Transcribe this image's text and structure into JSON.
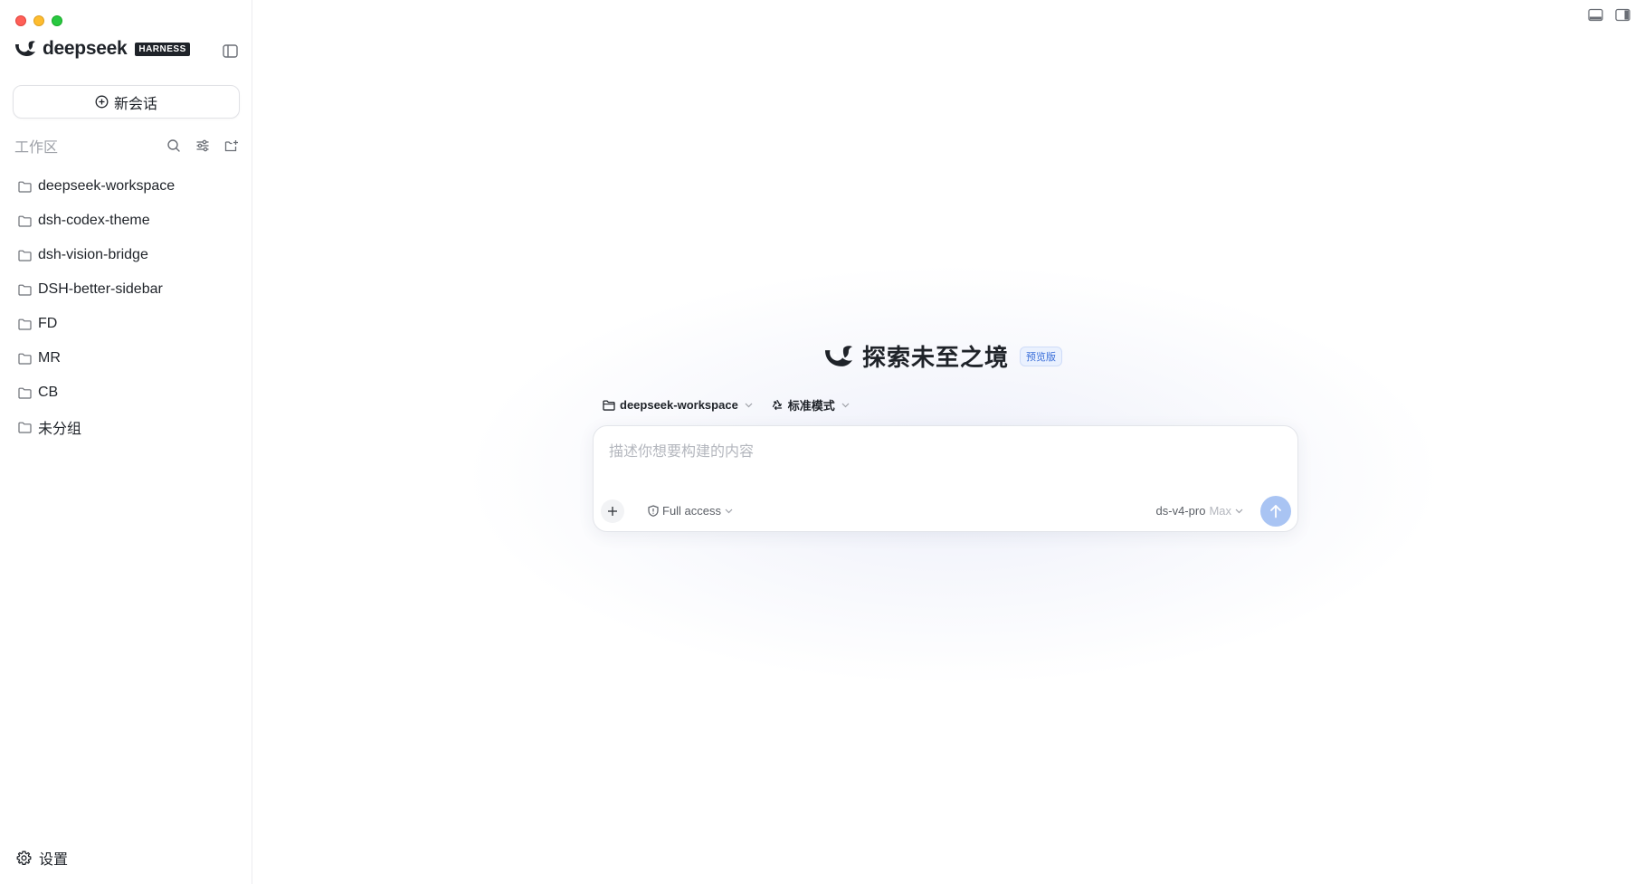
{
  "brand": {
    "name": "deepseek",
    "badge": "HARNESS"
  },
  "sidebar": {
    "new_chat_label": "新会话",
    "workspace_title": "工作区",
    "folders": [
      {
        "label": "deepseek-workspace"
      },
      {
        "label": "dsh-codex-theme"
      },
      {
        "label": "dsh-vision-bridge"
      },
      {
        "label": "DSH-better-sidebar"
      },
      {
        "label": "FD"
      },
      {
        "label": "MR"
      },
      {
        "label": "CB"
      },
      {
        "label": "未分组"
      }
    ],
    "settings_label": "设置"
  },
  "main": {
    "hero_title": "探索未至之境",
    "hero_badge": "预览版",
    "workspace_selector": "deepseek-workspace",
    "mode_selector": "标准模式",
    "composer": {
      "placeholder": "描述你想要构建的内容",
      "value": "",
      "access_label": "Full access",
      "model_name": "ds-v4-pro",
      "model_effort": "Max"
    }
  },
  "colors": {
    "accent": "#3b6fd9",
    "send_button": "#a9c4f3",
    "badge_bg": "#eaf1fe",
    "text_primary": "#1f2329",
    "text_muted": "#9ea1a8"
  },
  "icons": {
    "brand": "whale-logo-icon",
    "collapse": "sidebar-toggle-icon",
    "new_chat": "plus-circle-icon",
    "search": "search-icon",
    "filter": "sliders-icon",
    "new_folder": "folder-plus-icon",
    "folder": "folder-icon",
    "settings": "gear-icon",
    "panel_bottom": "panel-bottom-icon",
    "panel_right": "panel-right-icon",
    "plus": "plus-icon",
    "shield": "shield-icon",
    "chevron": "chevron-down-icon",
    "send": "arrow-up-icon"
  }
}
